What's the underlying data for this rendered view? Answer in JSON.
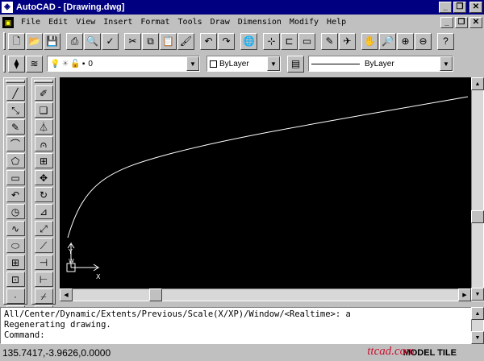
{
  "window": {
    "title": "AutoCAD - [Drawing.dwg]",
    "minimize": "_",
    "maximize": "❐",
    "close": "✕"
  },
  "menu": {
    "items": [
      "File",
      "Edit",
      "View",
      "Insert",
      "Format",
      "Tools",
      "Draw",
      "Dimension",
      "Modify",
      "Help"
    ],
    "doc_minimize": "_",
    "doc_restore": "❐",
    "doc_close": "✕"
  },
  "properties": {
    "layer": "0",
    "color": "ByLayer",
    "linetype": "ByLayer"
  },
  "command": {
    "lines": [
      "All/Center/Dynamic/Extents/Previous/Scale(X/XP)/Window/<Realtime>: a",
      "Regenerating drawing.",
      "Command:"
    ]
  },
  "status": {
    "coordinates": "135.7417,-3.9626,0.0000",
    "model": "MODEL",
    "tile": "TILE",
    "watermark": "ttcad.com"
  },
  "ucs": {
    "x_label": "X",
    "y_label": "Y",
    "w_label": "W"
  },
  "icons": {
    "standard": [
      "new-icon",
      "open-icon",
      "save-icon",
      "print-icon",
      "print-preview-icon",
      "spelling-icon",
      "cut-icon",
      "copy-icon",
      "paste-icon",
      "match-properties-icon",
      "undo-icon",
      "redo-icon",
      "launch-browser-icon",
      "object-snap-icon",
      "ucs-icon",
      "inquiry-icon",
      "redraw-icon",
      "aerial-view-icon",
      "pan-icon",
      "zoom-realtime-icon",
      "zoom-window-icon",
      "zoom-previous-icon",
      "help-icon"
    ],
    "draw": [
      "line-icon",
      "construction-line-icon",
      "polyline-icon",
      "polygon-icon",
      "rectangle-icon",
      "arc-icon",
      "circle-icon",
      "spline-icon",
      "ellipse-icon",
      "insert-block-icon",
      "make-block-icon",
      "point-icon",
      "hatch-icon",
      "region-icon"
    ],
    "modify": [
      "erase-icon",
      "copy-object-icon",
      "mirror-icon",
      "offset-icon",
      "array-icon",
      "move-icon",
      "rotate-icon",
      "scale-icon",
      "stretch-icon",
      "lengthen-icon",
      "trim-icon",
      "extend-icon",
      "break-icon",
      "chamfer-icon"
    ]
  },
  "colors": {
    "titlebar": "#000080",
    "canvas": "#000000",
    "curve": "#ffffff"
  }
}
